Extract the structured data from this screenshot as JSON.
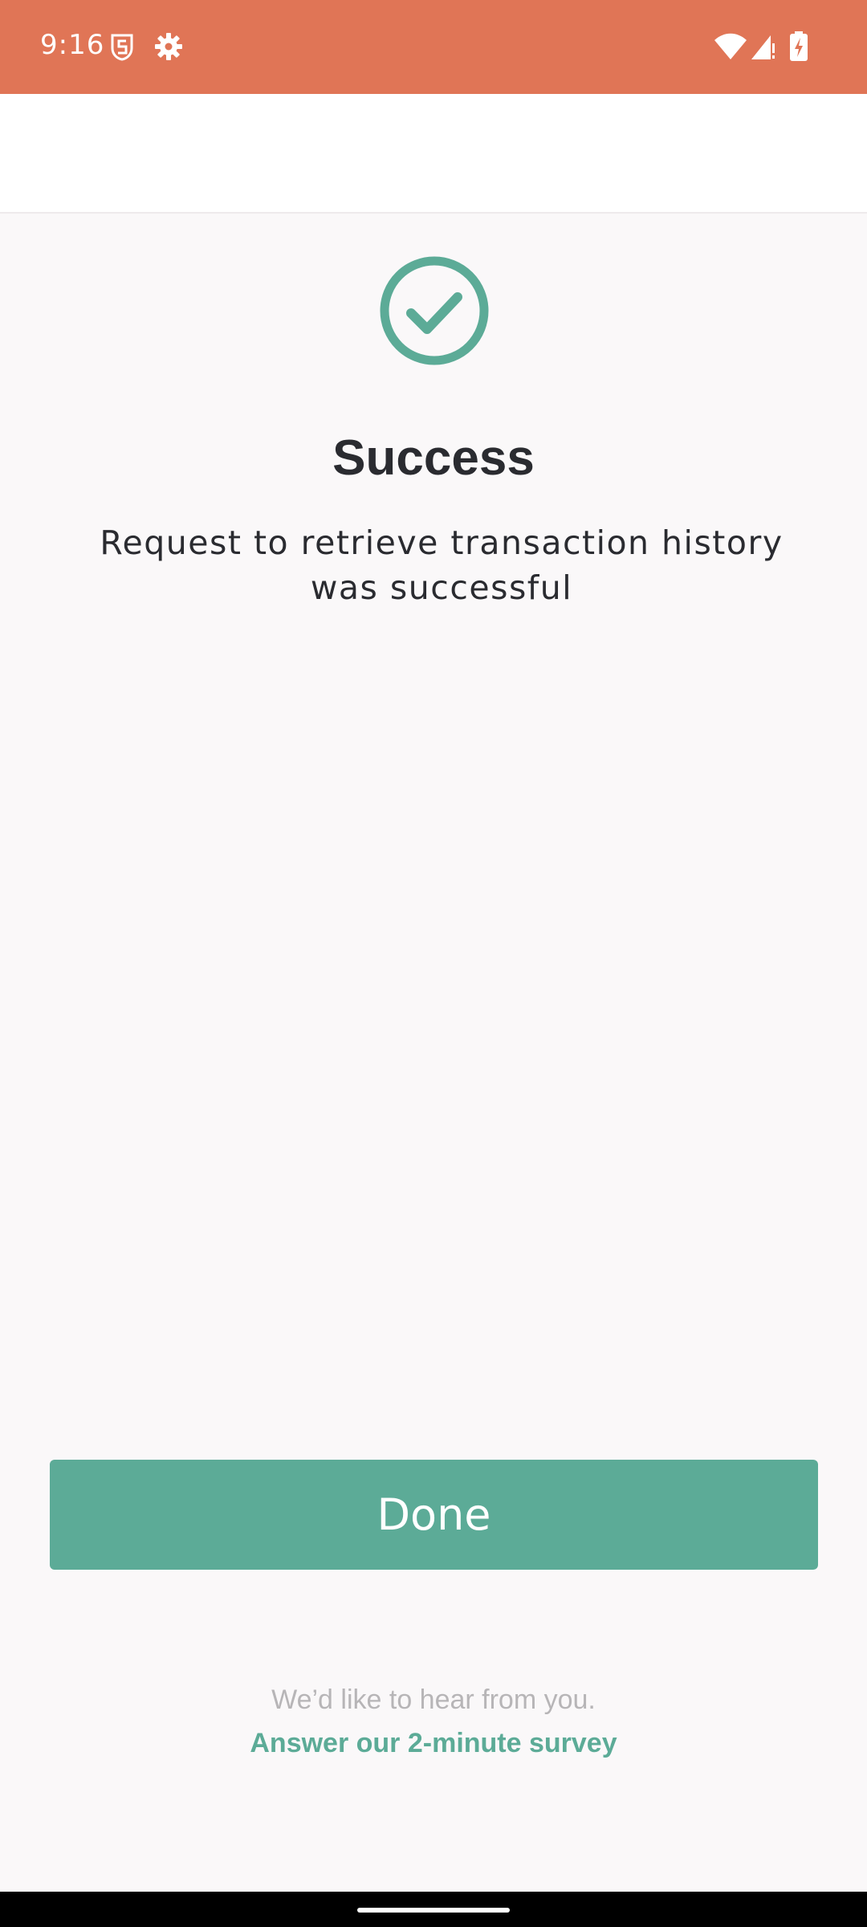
{
  "status_bar": {
    "time": "9:16",
    "color": "#e07556",
    "icons": [
      "shield-s-icon",
      "gear-icon",
      "wifi-icon",
      "signal-icon",
      "battery-charging-icon"
    ]
  },
  "main": {
    "icon": "check-circle-icon",
    "title": "Success",
    "message": "Request to retrieve transaction history was successful"
  },
  "actions": {
    "done_label": "Done"
  },
  "survey": {
    "prompt": "We’d like to hear from you.",
    "link_text": "Answer our 2-minute survey"
  },
  "colors": {
    "accent": "#5cab97",
    "status_bar": "#e07556",
    "text": "#2a2b30",
    "muted": "#b7b5b7"
  }
}
